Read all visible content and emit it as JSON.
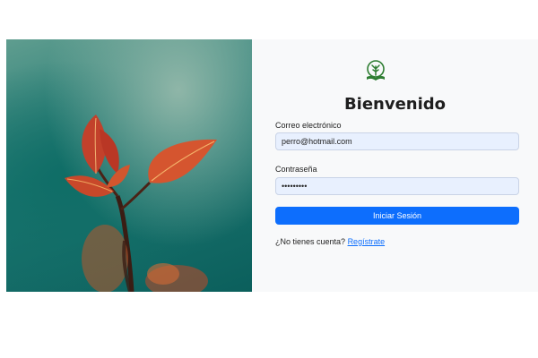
{
  "login": {
    "title": "Bienvenido",
    "email_label": "Correo electrónico",
    "email_value": "perro@hotmail.com",
    "password_label": "Contraseña",
    "password_value": "•••••••••",
    "submit_label": "Iniciar Sesión",
    "signup_prompt": "¿No tienes cuenta?",
    "signup_link": "Regístrate"
  },
  "icons": {
    "logo": "tree-book-logo-icon"
  },
  "colors": {
    "primary": "#0d6efd",
    "input_bg": "#e8f0fe",
    "logo_green": "#2e7d32",
    "page_bg": "#f8f9fa"
  }
}
